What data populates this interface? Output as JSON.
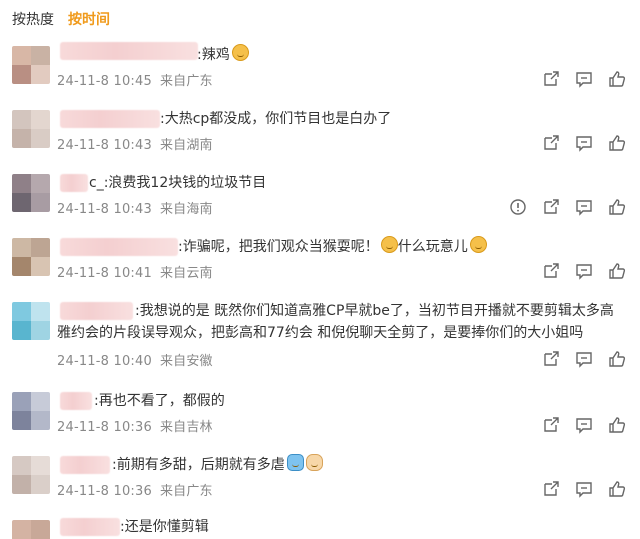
{
  "tabs": [
    {
      "label": "按热度",
      "active": false
    },
    {
      "label": "按时间",
      "active": true
    }
  ],
  "accent_color": "#f09a1b",
  "comments": [
    {
      "text": ":辣鸡",
      "emoji": "grin",
      "date": "24-11-8 10:45",
      "location": "来自广东",
      "actions": [
        "share-icon",
        "comment-icon",
        "like-icon"
      ]
    },
    {
      "text": ":大热cp都没成，你们节目也是白办了",
      "date": "24-11-8 10:43",
      "location": "来自湖南",
      "actions": [
        "share-icon",
        "comment-icon",
        "like-icon"
      ]
    },
    {
      "text": "c_:浪费我12块钱的垃圾节目",
      "date": "24-11-8 10:43",
      "location": "来自海南",
      "actions": [
        "report-icon",
        "share-icon",
        "comment-icon",
        "like-icon"
      ]
    },
    {
      "text": ":诈骗呢，把我们观众当猴耍呢！",
      "text2": "什么玩意儿",
      "date": "24-11-8 10:41",
      "location": "来自云南",
      "actions": [
        "share-icon",
        "comment-icon",
        "like-icon"
      ]
    },
    {
      "text": ":我想说的是 既然你们知道高雅CP早就be了，当初节目开播就不要剪辑太多高雅约会的片段误导观众，把彭高和77约会 和倪倪聊天全剪了，是要捧你们的大小姐吗",
      "date": "24-11-8 10:40",
      "location": "来自安徽",
      "actions": [
        "share-icon",
        "comment-icon",
        "like-icon"
      ]
    },
    {
      "text": ":再也不看了，都假的",
      "date": "24-11-8 10:36",
      "location": "来自吉林",
      "actions": [
        "share-icon",
        "comment-icon",
        "like-icon"
      ]
    },
    {
      "text": ":前期有多甜，后期就有多虐",
      "date": "24-11-8 10:36",
      "location": "来自广东",
      "actions": [
        "share-icon",
        "comment-icon",
        "like-icon"
      ]
    },
    {
      "text": ":还是你懂剪辑",
      "date": "",
      "location": "",
      "actions": []
    }
  ]
}
